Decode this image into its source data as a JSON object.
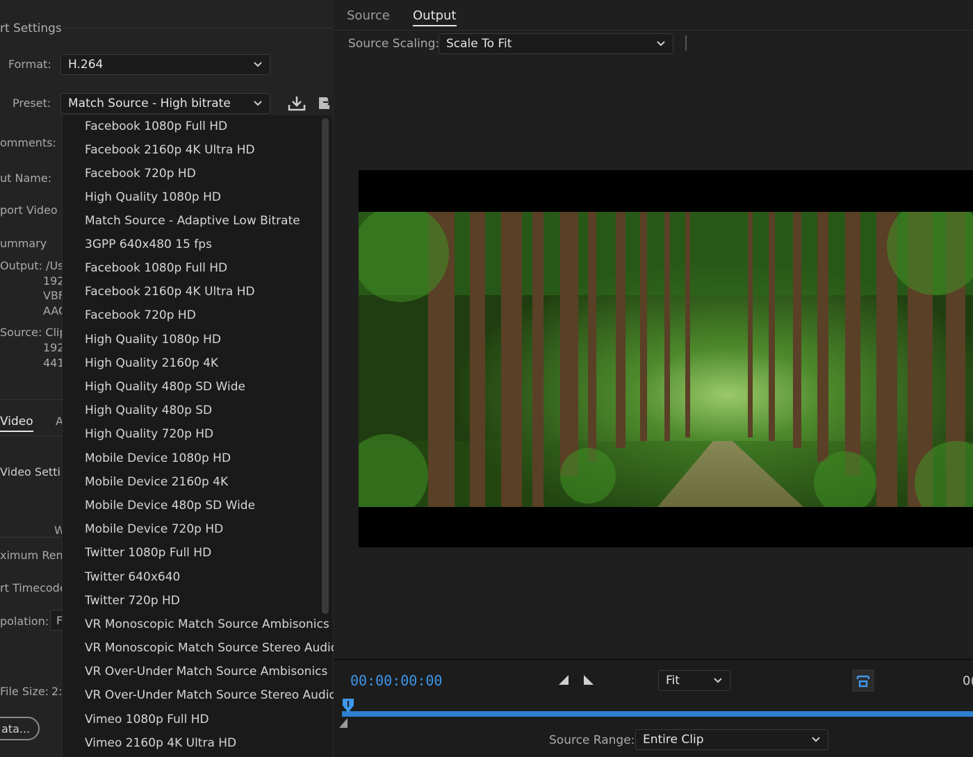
{
  "left": {
    "section_title": "rt Settings",
    "format_label": "Format:",
    "format_value": "H.264",
    "preset_label": "Preset:",
    "preset_value": "Match Source - High bitrate",
    "comments_label": "omments:",
    "output_name_label": "ut Name:",
    "export_video_label": "port Video",
    "summary_label": "ummary",
    "output_label": "Output: /Us",
    "output_lines": [
      "192",
      "VBF",
      "AAC"
    ],
    "source_label": "Source: Clip",
    "source_lines": [
      "192",
      "441"
    ],
    "video_tab": "Video",
    "audio_tab_fragment": "A",
    "video_settings_label": "Video Setti",
    "width_fragment": "W",
    "max_render_label": "ximum Ren",
    "start_timecode_label": "rt Timecode",
    "interpolation_label": "polation:",
    "interpolation_fragment": "F",
    "file_size_label": "File Size:",
    "file_size_fragment": "2:",
    "metadata_button": "ata..."
  },
  "preset_dropdown": {
    "items": [
      "Facebook 1080p Full HD",
      "Facebook 2160p 4K Ultra HD",
      "Facebook 720p HD",
      "High Quality 1080p HD",
      "Match Source - Adaptive Low Bitrate",
      "3GPP 640x480 15 fps",
      "Facebook 1080p Full HD",
      "Facebook 2160p 4K Ultra HD",
      "Facebook 720p HD",
      "High Quality 1080p HD",
      "High Quality 2160p 4K",
      "High Quality 480p SD Wide",
      "High Quality 480p SD",
      "High Quality 720p HD",
      "Mobile Device 1080p HD",
      "Mobile Device 2160p 4K",
      "Mobile Device 480p SD Wide",
      "Mobile Device 720p HD",
      "Twitter 1080p Full HD",
      "Twitter 640x640",
      "Twitter 720p HD",
      "VR Monoscopic Match Source Ambisonics",
      "VR Monoscopic Match Source Stereo Audio",
      "VR Over-Under Match Source Ambisonics",
      "VR Over-Under Match Source Stereo Audio",
      "Vimeo 1080p Full HD",
      "Vimeo 2160p 4K Ultra HD"
    ]
  },
  "right": {
    "tabs": [
      "Source",
      "Output"
    ],
    "active_tab": "Output",
    "source_scaling_label": "Source Scaling:",
    "source_scaling_value": "Scale To Fit",
    "timecode": "00:00:00:00",
    "zoom_value": "Fit",
    "end_time_fragment": "0(",
    "source_range_label": "Source Range:",
    "source_range_value": "Entire Clip"
  },
  "colors": {
    "accent": "#3d96ea",
    "panel_bg": "#232323",
    "dropdown_bg": "#1a1a1a"
  },
  "icons": [
    "save-preset-icon",
    "import-preset-icon",
    "chevron-down-icon",
    "mark-in-icon",
    "mark-out-icon",
    "fit-frame-icon",
    "playhead-icon"
  ]
}
